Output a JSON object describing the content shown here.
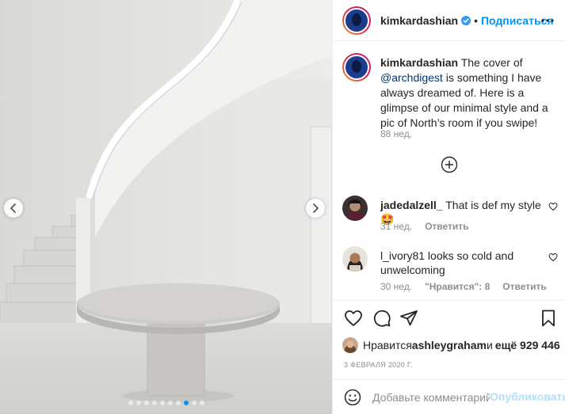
{
  "header": {
    "username": "kimkardashian",
    "bullet": "•",
    "follow_label": "Подписаться"
  },
  "caption": {
    "username": "kimkardashian",
    "text_before": " The cover of ",
    "mention": "@archdigest",
    "text_after": " is something I have always dreamed of. Here is a glimpse of our minimal style and a pic of North’s room if you swipe!",
    "time": "88 нед."
  },
  "comments": [
    {
      "username": "jadedalzell_",
      "text": " That is def my style 🤩",
      "time": "31 нед.",
      "reply_label": "Ответить"
    },
    {
      "username": "l_ivory81",
      "text": " looks so cold and unwelcoming",
      "time": "30 нед.",
      "likes_label": "\"Нравится\": 8",
      "reply_label": "Ответить"
    }
  ],
  "likes": {
    "prefix": "Нравится ",
    "user": "ashleygraham",
    "suffix": " и ",
    "count": "ещё 929 446"
  },
  "date": "3 ФЕВРАЛЯ 2020 Г.",
  "add_comment": {
    "placeholder": "Добавьте комментарий...",
    "post_label": "Опубликовать"
  },
  "carousel": {
    "total": 10,
    "active_index": 7
  },
  "colors": {
    "accent": "#0095f6",
    "post_disabled": "#b2dffc",
    "muted": "#8e8e8e",
    "text": "#262626"
  },
  "icons": [
    "verified-badge-icon",
    "more-options-icon",
    "plus-circle-icon",
    "heart-icon",
    "comment-icon",
    "share-icon",
    "bookmark-icon",
    "emoji-icon",
    "chevron-left-icon",
    "chevron-right-icon"
  ]
}
